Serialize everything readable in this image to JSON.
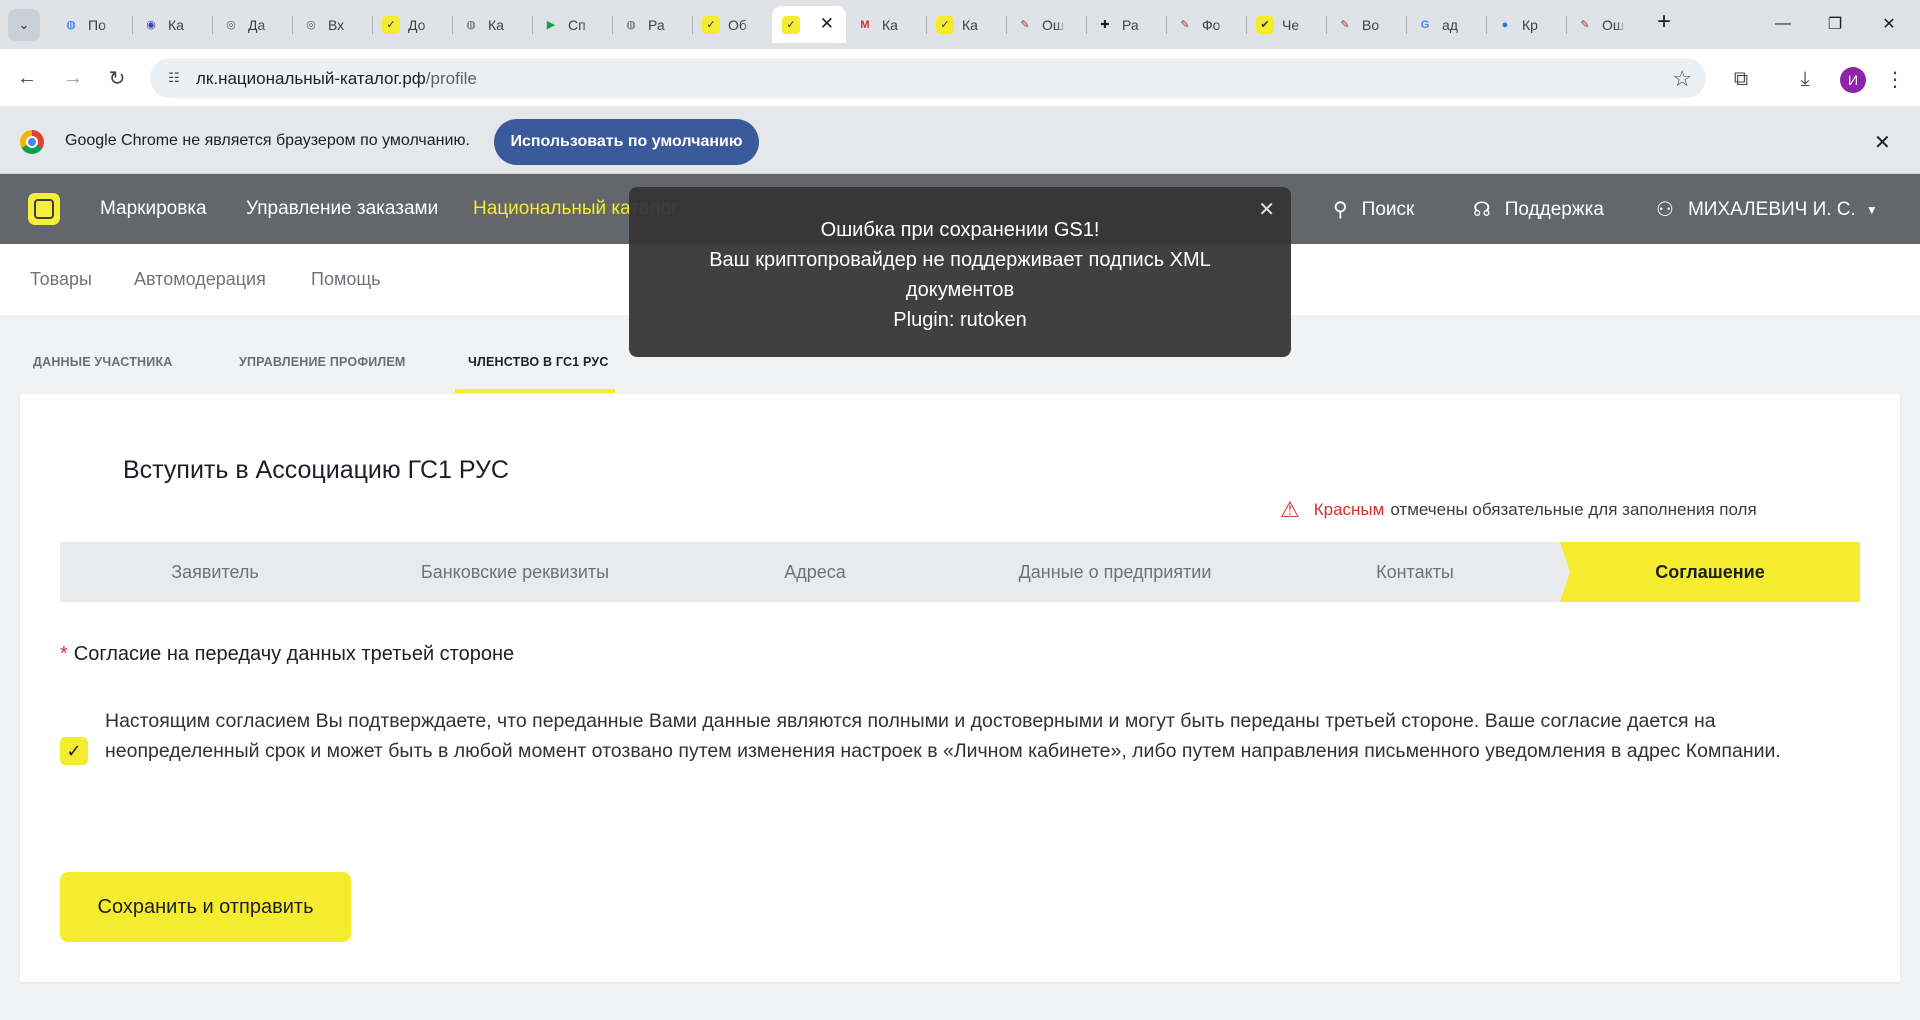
{
  "browser": {
    "tabs": [
      {
        "title": "По",
        "icon": "globe-icon",
        "color": "#1a73e8"
      },
      {
        "title": "Ка",
        "icon": "crypto-icon",
        "color": "#3949ab"
      },
      {
        "title": "Да",
        "icon": "spiral-icon",
        "color": "#5f6368"
      },
      {
        "title": "Вх",
        "icon": "spiral-icon",
        "color": "#5f6368"
      },
      {
        "title": "До",
        "icon": "chestny-znak-icon",
        "color": "#f5ec30"
      },
      {
        "title": "Ка",
        "icon": "globe-icon",
        "color": "#5f6368"
      },
      {
        "title": "Сп",
        "icon": "play-icon",
        "color": "#1e9e3f"
      },
      {
        "title": "Ра",
        "icon": "globe-icon",
        "color": "#5f6368"
      },
      {
        "title": "Об",
        "icon": "chestny-znak-icon",
        "color": "#f5ec30"
      },
      {
        "title": "",
        "icon": "chestny-znak-icon",
        "color": "#f5ec30",
        "active": true
      },
      {
        "title": "Ка",
        "icon": "mail-m-icon",
        "color": "#d93025"
      },
      {
        "title": "Ка",
        "icon": "chestny-znak-icon",
        "color": "#f5ec30"
      },
      {
        "title": "Ош",
        "icon": "bookmark-icon",
        "color": "#c62828"
      },
      {
        "title": "Ра",
        "icon": "puzzle-icon",
        "color": "#202124"
      },
      {
        "title": "Фо",
        "icon": "bookmark-icon",
        "color": "#c62828"
      },
      {
        "title": "Че",
        "icon": "check-icon",
        "color": "#f5ec30"
      },
      {
        "title": "Во",
        "icon": "bookmark-icon",
        "color": "#c62828"
      },
      {
        "title": "ад",
        "icon": "google-icon",
        "color": "#4285f4"
      },
      {
        "title": "Кр",
        "icon": "circle-icon",
        "color": "#1a73e8"
      },
      {
        "title": "Ош",
        "icon": "bookmark-icon",
        "color": "#c62828"
      }
    ],
    "url_host": "лк.национальный-каталог.рф",
    "url_path": "/profile",
    "profile_initial": "И",
    "infobar_text": "Google Chrome не является браузером по умолчанию.",
    "infobar_button": "Использовать по умолчанию"
  },
  "header": {
    "nav": [
      {
        "label": "Маркировка"
      },
      {
        "label": "Управление заказами"
      },
      {
        "label": "Национальный каталог",
        "active": true
      }
    ],
    "search_label": "Поиск",
    "support_label": "Поддержка",
    "user_label": "МИХАЛЕВИЧ И. С."
  },
  "subnav": [
    "Товары",
    "Автомодерация",
    "Помощь"
  ],
  "profile_tabs": [
    {
      "label": "ДАННЫЕ УЧАСТНИКА"
    },
    {
      "label": "УПРАВЛЕНИЕ ПРОФИЛЕМ"
    },
    {
      "label": "ЧЛЕНСТВО В ГС1 РУС",
      "active": true
    }
  ],
  "card": {
    "title": "Вступить в Ассоциацию ГС1 РУС",
    "required_red": "Красным",
    "required_rest": "отмечены обязательные для заполнения поля",
    "steps": [
      "Заявитель",
      "Банковские реквизиты",
      "Адреса",
      "Данные о предприятии",
      "Контакты",
      "Соглашение"
    ],
    "active_step": "Соглашение",
    "consent_title": "Согласие на передачу данных третьей стороне",
    "consent_checked": true,
    "consent_text": "Настоящим согласием Вы подтверждаете, что переданные Вами данные являются полными и достоверными и могут быть переданы третьей стороне. Ваше согласие дается на неопределенный срок и может быть в любой момент отозвано путем изменения настроек в «Личном кабинете», либо путем направления письменного уведомления в адрес Компании.",
    "submit_label": "Сохранить и отправить"
  },
  "toast": {
    "lines": [
      "Ошибка при сохранении GS1!",
      "Ваш криптопровайдер не поддерживает подпись XML",
      "документов",
      "Plugin: rutoken"
    ]
  },
  "colors": {
    "brand_yellow": "#f5ec30",
    "header_gray": "#63666a",
    "required_red": "#d32f2f"
  }
}
